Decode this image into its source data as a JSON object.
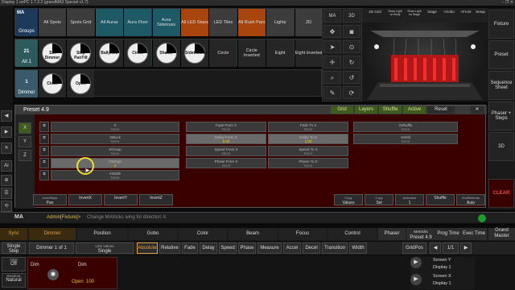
{
  "window": {
    "title": "Display 1 onPC 1.7.2.2 (grandMA3 Special v1.7)",
    "controls": "–  ❐  ✕"
  },
  "left": {
    "buttons": [
      "◀",
      "▶",
      "✕",
      "AI",
      "⊕",
      "☰",
      "⟲"
    ]
  },
  "pools": {
    "groups": {
      "header": "Groups",
      "tiles": [
        {
          "label": "All Spots",
          "color": "#3c3c3c"
        },
        {
          "label": "Spots Grid",
          "color": "#3c3c3c"
        },
        {
          "label": "All Auras",
          "color": "#1d5a66"
        },
        {
          "label": "Aura Floor",
          "color": "#1d5a66"
        },
        {
          "label": "Aura Sidetruss",
          "color": "#1d5a66"
        },
        {
          "label": "All LED Steps",
          "color": "#a8450e"
        },
        {
          "label": "LED Tiles",
          "color": "#3c3c3c"
        },
        {
          "label": "All Rush Pars",
          "color": "#a8450e"
        },
        {
          "label": "Lights",
          "color": "#3c3c3c"
        },
        {
          "label": "2D",
          "color": "#3c3c3c"
        }
      ]
    },
    "seq1": {
      "header_num": "21",
      "header_label": "All 1",
      "tiles": [
        {
          "label": "Sin Dimmer"
        },
        {
          "label": "Step PanTilt"
        },
        {
          "label": "Ballyhoo"
        },
        {
          "label": "Circle"
        },
        {
          "label": "Shaker"
        },
        {
          "label": "Sidetrucker"
        },
        {
          "label": "Circle",
          "plain": true
        },
        {
          "label": "Circle Inverted",
          "plain": true
        },
        {
          "label": "Eight",
          "plain": true
        },
        {
          "label": "Eight Inverted",
          "plain": true
        }
      ]
    },
    "seq2": {
      "header_num": "1",
      "header_label": "Dimmer",
      "tiles": [
        {
          "label": "Close"
        },
        {
          "label": "Open"
        }
      ]
    }
  },
  "viewctl": {
    "ma": "MA",
    "three_d": "3D"
  },
  "view3d": {
    "toolbar": [
      "2D Grid",
      "Show Light on Body",
      "Show Light on Stage",
      "Stage",
      "<Gobo",
      "<Front",
      "Setup"
    ]
  },
  "right": {
    "buttons": [
      "Fixture",
      "Preset",
      "Sequence Sheet",
      "Phaser + Steps",
      "3D",
      "CLEAR"
    ]
  },
  "preset_window": {
    "title": "Preset 4.9",
    "tabs": [
      "Grid",
      "Layers",
      "Shuffle",
      "Active"
    ],
    "reset": "Reset",
    "axes": [
      "X",
      "Y",
      "Z"
    ],
    "col1": [
      {
        "label": "X",
        "value": "None"
      },
      {
        "label": "XBlock",
        "value": "None"
      },
      {
        "label": "XGroup",
        "value": "None"
      },
      {
        "label": "XWings",
        "value": "2"
      },
      {
        "label": "XWidth",
        "value": "None"
      }
    ],
    "col2": [
      {
        "label": "Fade From X",
        "value": "None"
      },
      {
        "label": "Delay From X",
        "value": "0.00"
      },
      {
        "label": "Speed From X",
        "value": "None"
      },
      {
        "label": "Phase From X",
        "value": "None"
      }
    ],
    "col3": [
      {
        "label": "Fade To X",
        "value": "None"
      },
      {
        "label": "Delay To X",
        "value": "1.00"
      },
      {
        "label": "Speed To X",
        "value": "None"
      },
      {
        "label": "Phase To X",
        "value": "None"
      }
    ],
    "col4": [
      {
        "label": "XShuffle",
        "value": "None"
      },
      {
        "label": "XShift",
        "value": "None"
      }
    ],
    "bottom_left": [
      {
        "label": "InvertStyle",
        "value": "Pan"
      },
      {
        "label": "",
        "value": "InvertX"
      },
      {
        "label": "",
        "value": "InvertY"
      },
      {
        "label": "",
        "value": "InvertZ"
      }
    ],
    "bottom_right": [
      {
        "label": "Copy",
        "value": "Values"
      },
      {
        "label": "Copy",
        "value": "Sel"
      },
      {
        "label": "Activated",
        "value": "1"
      },
      {
        "label": "",
        "value": "Shuffle"
      },
      {
        "label": "ShuffleMode",
        "value": "Auto"
      }
    ]
  },
  "cmdline": {
    "ma": "MA",
    "prompt": "Admin[Fixture]>",
    "text": "Change MAtricks wing for direction X"
  },
  "preset_bar": {
    "tabs": [
      "Sync",
      "Dimmer",
      "Position",
      "Gobo",
      "Color",
      "Beam",
      "Focus",
      "Control",
      "Phaser"
    ],
    "matricks_label": "MAtricks",
    "matricks_value": "Preset 4.9",
    "right": [
      "Prog Time",
      "Exec Time",
      "Grand Master"
    ]
  },
  "toolbar2": {
    "single": "Single Step",
    "dimmer": "Dimmer 1 of 1",
    "link_label": "Link Values",
    "link_value": "Single",
    "buttons": [
      "Absolute",
      "Relative",
      "Fade",
      "Delay",
      "Speed",
      "Phase",
      "Measure",
      "Accel",
      "Decel",
      "Transition",
      "Width"
    ],
    "gridpos": "GridPos",
    "page": "1/1"
  },
  "bottom": {
    "align_label": "Align",
    "align_value": "Off",
    "readout_label": "Readout",
    "readout_value": "Natural",
    "dim_label": "Dim",
    "dim_title": "Dim",
    "open": "Open",
    "open_val": "100",
    "screens": [
      "Screen Y",
      "Display 1",
      "Screen X",
      "Display 1"
    ]
  }
}
